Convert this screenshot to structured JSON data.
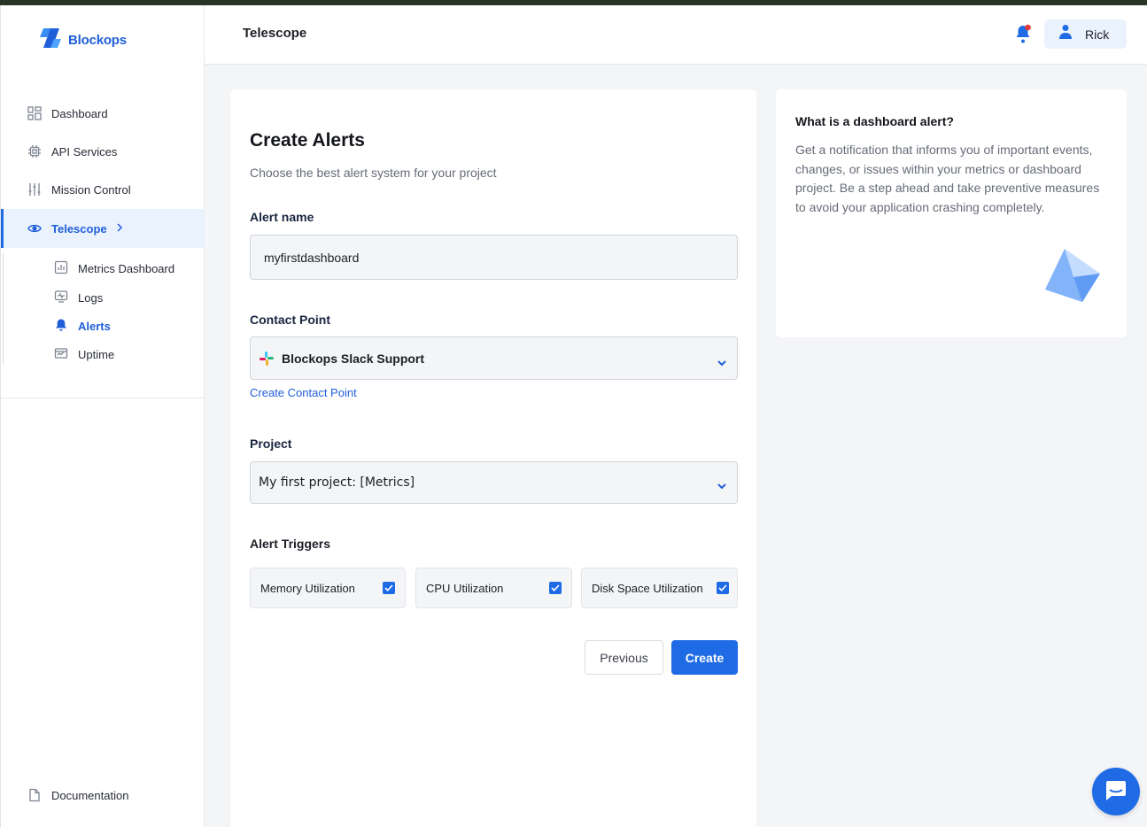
{
  "brand": {
    "name": "Blockops",
    "color": "#1f5fd9"
  },
  "sidebar": {
    "items": [
      {
        "label": "Dashboard",
        "icon": "grid-icon"
      },
      {
        "label": "API Services",
        "icon": "chip-icon"
      },
      {
        "label": "Mission Control",
        "icon": "sliders-icon"
      },
      {
        "label": "Telescope",
        "icon": "eye-icon",
        "active": true
      }
    ],
    "subitems": [
      {
        "label": "Metrics Dashboard",
        "icon": "bar-chart-icon"
      },
      {
        "label": "Logs",
        "icon": "monitor-icon"
      },
      {
        "label": "Alerts",
        "icon": "bell-icon",
        "active": true
      },
      {
        "label": "Uptime",
        "icon": "uptime-icon"
      }
    ],
    "footer": {
      "label": "Documentation",
      "icon": "document-icon"
    }
  },
  "header": {
    "title": "Telescope",
    "user": {
      "name": "Rick"
    }
  },
  "form": {
    "title": "Create Alerts",
    "subtitle": "Choose the best alert system for your project",
    "alert_name": {
      "label": "Alert name",
      "value": "myfirstdashboard"
    },
    "contact_point": {
      "label": "Contact Point",
      "value": "Blockops Slack Support",
      "create_link": "Create Contact Point"
    },
    "project": {
      "label": "Project",
      "value": "My first project: [Metrics]"
    },
    "triggers": {
      "label": "Alert Triggers",
      "items": [
        {
          "label": "Memory Utilization",
          "checked": true
        },
        {
          "label": "CPU Utilization",
          "checked": true
        },
        {
          "label": "Disk Space Utilization",
          "checked": true
        }
      ]
    },
    "buttons": {
      "previous": "Previous",
      "create": "Create"
    }
  },
  "info": {
    "title": "What is a dashboard alert?",
    "body": "Get a notification that informs you of important events, changes, or issues within your metrics or dashboard project. Be a step ahead and take preventive measures to avoid your application crashing completely."
  },
  "colors": {
    "accent": "#1f6be5",
    "active_bg": "#eaf2fd",
    "notification_dot": "#e53935"
  }
}
